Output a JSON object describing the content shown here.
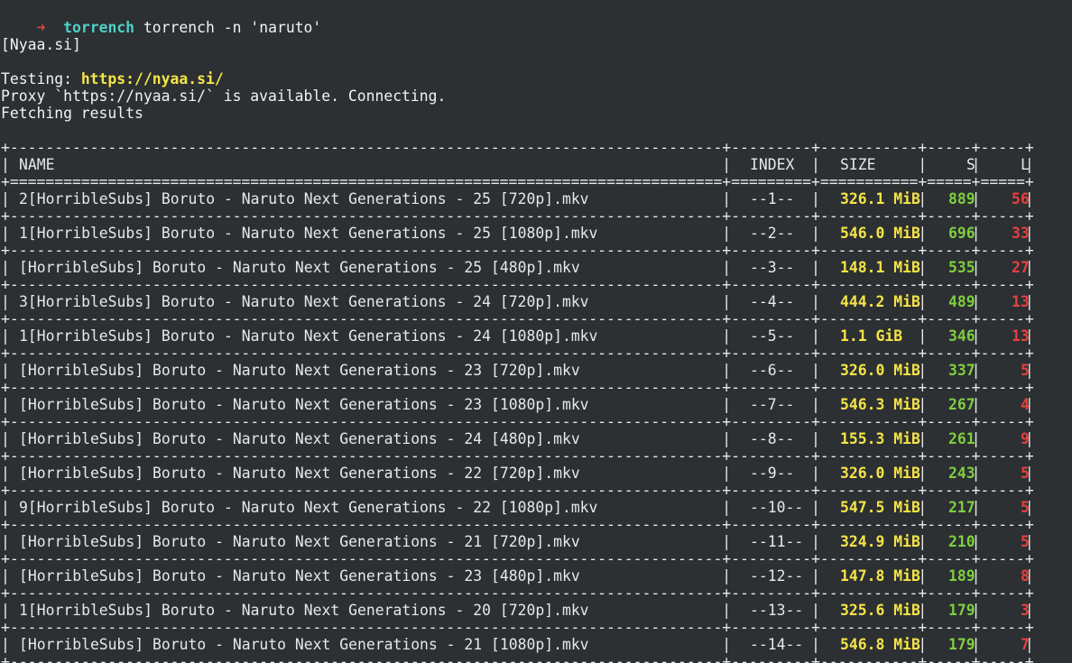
{
  "prompt": {
    "arrow": "➜",
    "cwd": "torrench",
    "command": "torrench -n 'naruto'"
  },
  "output": {
    "site_tag": "[Nyaa.si]",
    "testing_label": "Testing: ",
    "testing_url": "https://nyaa.si/",
    "proxy_line": "Proxy `https://nyaa.si/` is available. Connecting.",
    "fetching_line": "Fetching results"
  },
  "table": {
    "columns": [
      "NAME",
      "INDEX",
      "SIZE",
      "S",
      "L"
    ],
    "rows": [
      {
        "name": "2[HorribleSubs] Boruto - Naruto Next Generations - 25 [720p].mkv",
        "index": "--1--",
        "size": "326.1 MiB",
        "seeds": "889",
        "leeches": "56"
      },
      {
        "name": "1[HorribleSubs] Boruto - Naruto Next Generations - 25 [1080p].mkv",
        "index": "--2--",
        "size": "546.0 MiB",
        "seeds": "696",
        "leeches": "33"
      },
      {
        "name": "[HorribleSubs] Boruto - Naruto Next Generations - 25 [480p].mkv",
        "index": "--3--",
        "size": "148.1 MiB",
        "seeds": "535",
        "leeches": "27"
      },
      {
        "name": "3[HorribleSubs] Boruto - Naruto Next Generations - 24 [720p].mkv",
        "index": "--4--",
        "size": "444.2 MiB",
        "seeds": "489",
        "leeches": "13"
      },
      {
        "name": "1[HorribleSubs] Boruto - Naruto Next Generations - 24 [1080p].mkv",
        "index": "--5--",
        "size": "1.1 GiB",
        "seeds": "346",
        "leeches": "13"
      },
      {
        "name": "[HorribleSubs] Boruto - Naruto Next Generations - 23 [720p].mkv",
        "index": "--6--",
        "size": "326.0 MiB",
        "seeds": "337",
        "leeches": "5"
      },
      {
        "name": "[HorribleSubs] Boruto - Naruto Next Generations - 23 [1080p].mkv",
        "index": "--7--",
        "size": "546.3 MiB",
        "seeds": "267",
        "leeches": "4"
      },
      {
        "name": "[HorribleSubs] Boruto - Naruto Next Generations - 24 [480p].mkv",
        "index": "--8--",
        "size": "155.3 MiB",
        "seeds": "261",
        "leeches": "9"
      },
      {
        "name": "[HorribleSubs] Boruto - Naruto Next Generations - 22 [720p].mkv",
        "index": "--9--",
        "size": "326.0 MiB",
        "seeds": "243",
        "leeches": "5"
      },
      {
        "name": "9[HorribleSubs] Boruto - Naruto Next Generations - 22 [1080p].mkv",
        "index": "--10--",
        "size": "547.5 MiB",
        "seeds": "217",
        "leeches": "5"
      },
      {
        "name": "[HorribleSubs] Boruto - Naruto Next Generations - 21 [720p].mkv",
        "index": "--11--",
        "size": "324.9 MiB",
        "seeds": "210",
        "leeches": "5"
      },
      {
        "name": "[HorribleSubs] Boruto - Naruto Next Generations - 23 [480p].mkv",
        "index": "--12--",
        "size": "147.8 MiB",
        "seeds": "189",
        "leeches": "8"
      },
      {
        "name": "1[HorribleSubs] Boruto - Naruto Next Generations - 20 [720p].mkv",
        "index": "--13--",
        "size": "325.6 MiB",
        "seeds": "179",
        "leeches": "3"
      },
      {
        "name": "[HorribleSubs] Boruto - Naruto Next Generations - 21 [1080p].mkv",
        "index": "--14--",
        "size": "546.8 MiB",
        "seeds": "179",
        "leeches": "7"
      }
    ]
  },
  "colors": {
    "background": "#2c3033",
    "foreground": "#f2f2f2",
    "prompt_arrow": "#e24a3b",
    "prompt_cwd": "#4fd0c6",
    "url": "#f5e447",
    "size": "#f5e447",
    "seeds": "#7fce3f",
    "leeches": "#e8413c"
  }
}
